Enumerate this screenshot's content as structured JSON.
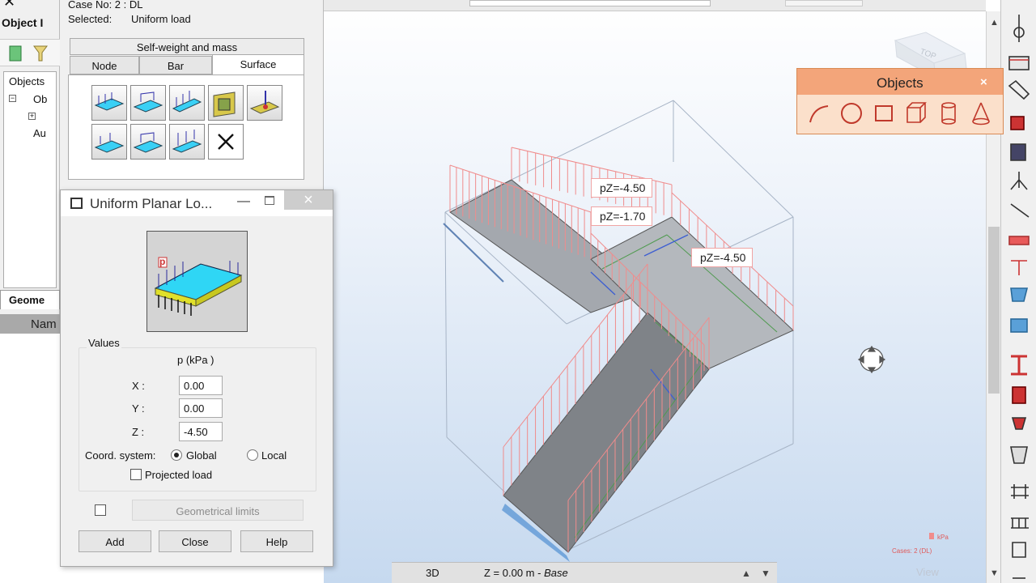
{
  "left_panel": {
    "title": "Object I",
    "tree": [
      {
        "label": "Objects"
      },
      {
        "label": "Ob"
      },
      {
        "label": "Au"
      }
    ],
    "tab_label": "Geome",
    "column_header": "Nam"
  },
  "palette": {
    "case_line": "Case No: 2 : DL",
    "selected_label": "Selected:",
    "selected_value": "Uniform load",
    "self_weight_button": "Self-weight and mass",
    "tabs": [
      {
        "label": "Node"
      },
      {
        "label": "Bar"
      },
      {
        "label": "Surface"
      }
    ]
  },
  "dialog": {
    "title": "Uniform Planar Lo...",
    "preview_letter": "p",
    "values_group": "Values",
    "unit_label": "p  (kPa )",
    "x_label": "X :",
    "x_value": "0.00",
    "y_label": "Y :",
    "y_value": "0.00",
    "z_label": "Z :",
    "z_value": "-4.50",
    "coord_label": "Coord. system:",
    "coord_options": [
      "Global",
      "Local"
    ],
    "coord_selected": "Global",
    "projected_label": "Projected load",
    "projected_checked": false,
    "geo_limits_checked": false,
    "geo_limits_label": "Geometrical limits",
    "buttons": {
      "add": "Add",
      "close": "Close",
      "help": "Help"
    }
  },
  "objects_toolbar": {
    "title": "Objects",
    "close_glyph": "×",
    "tools": [
      "arc-icon",
      "circle-icon",
      "rectangle-icon",
      "cube-icon",
      "cylinder-icon",
      "cone-icon"
    ]
  },
  "model_labels": [
    {
      "text": "pZ=-4.50"
    },
    {
      "text": "pZ=-1.70"
    },
    {
      "text": "pZ=-4.50"
    }
  ],
  "legend": {
    "unit": "kPa",
    "cases": "Cases: 2 (DL)"
  },
  "status_bar": {
    "view_mode": "3D",
    "level": "Z = 0.00 m - ",
    "level_name": "Base"
  },
  "view_label": "View",
  "colors": {
    "load_lines": "#f08c8c",
    "slab": "#8e9196",
    "objects_header": "#f3a57a",
    "viewport_bottom": "#c6d9ef"
  }
}
